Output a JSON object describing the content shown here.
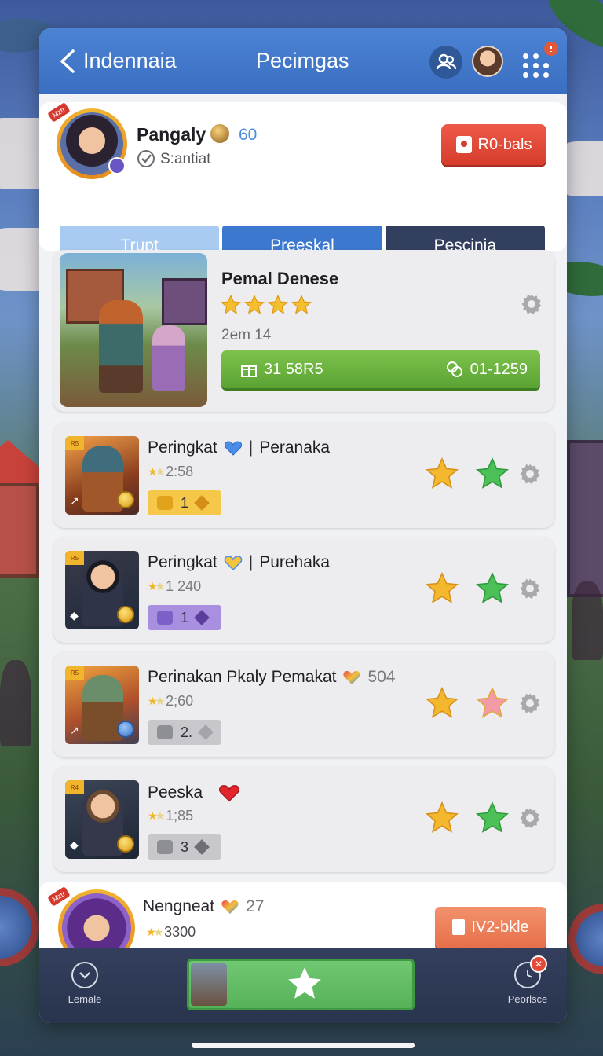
{
  "header": {
    "back_label": "",
    "brand": "Indennaia",
    "title": "Pecimgas",
    "notification_count": ""
  },
  "profile": {
    "avatar_badge": "Mztr",
    "name": "Pangaly",
    "level": "60",
    "status": "S:antiat",
    "action_button": "R0-bals"
  },
  "tabs": [
    {
      "label": "Trupt",
      "active": false
    },
    {
      "label": "Preeskal",
      "active": true
    },
    {
      "label": "Pescinia",
      "active": false
    }
  ],
  "featured": {
    "title": "Pemal Denese",
    "rating_stars": 4,
    "subtitle": "2em 14",
    "bar_left": "31 58R5",
    "bar_right": "01-1259"
  },
  "rows": [
    {
      "rank_tag": "R5",
      "name": "Peringkat",
      "name_icon": "blue-heart-icon",
      "separator": "|",
      "secondary": "Peranaka",
      "score": "2:58",
      "pill_value": "1",
      "pill_color": "#f5c84a",
      "star_colors": [
        "#f4b82e",
        "#4cc056"
      ]
    },
    {
      "rank_tag": "R5",
      "name": "Peringkat",
      "name_icon": "gold-heart-icon",
      "separator": "|",
      "secondary": "Purehaka",
      "score": "1 240",
      "pill_value": "1",
      "pill_color": "#a98fe0",
      "star_colors": [
        "#f4b82e",
        "#4cc056"
      ]
    },
    {
      "rank_tag": "R5",
      "name": "Perinakan Pkaly Pemakat",
      "name_icon": "multicolor-heart-icon",
      "separator": "",
      "secondary": "504",
      "score": "2;60",
      "pill_value": "2.",
      "pill_color": "#c8c8cc",
      "star_colors": [
        "#f4b82e",
        "#f29aa6"
      ]
    },
    {
      "rank_tag": "R4",
      "name": "Peeska",
      "name_icon": "red-heart-icon",
      "separator": "",
      "secondary": "",
      "score": "1;85",
      "pill_value": "3",
      "pill_color": "#c8c8cc",
      "star_colors": [
        "#f4b82e",
        "#4cc056"
      ]
    }
  ],
  "peek_card": {
    "avatar_badge": "Mztr",
    "name": "Nengneat",
    "count": "27",
    "score": "3300",
    "button_label": "IV2-bkle"
  },
  "bottom_nav": {
    "left_label": "Lemale",
    "right_label": "Peorlsce",
    "right_alert": "✕"
  },
  "colors": {
    "header_blue": "#3a6ec2",
    "action_red": "#d63c2c",
    "featured_green": "#5aa333",
    "nav_dark": "#29344e"
  }
}
